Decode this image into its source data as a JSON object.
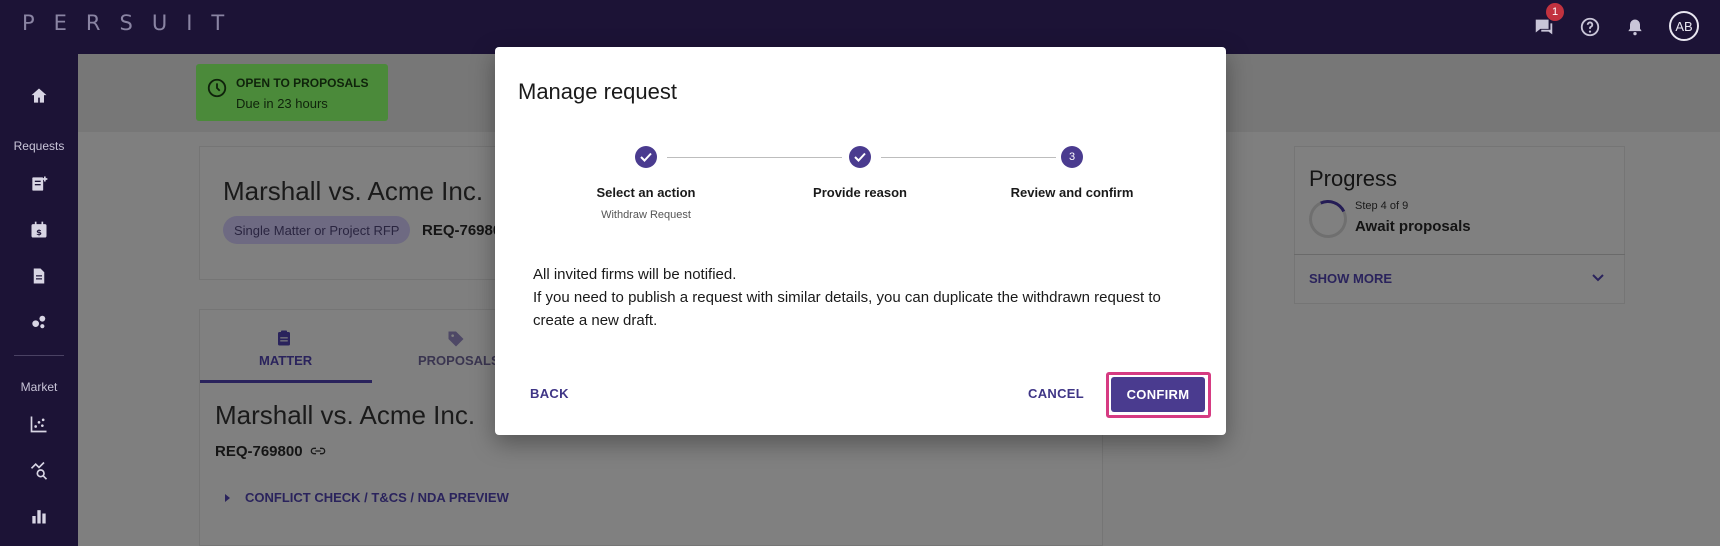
{
  "app": {
    "logo": "PERSUIT",
    "notification_count": "1",
    "user_initials": "AB"
  },
  "sidebar": {
    "requests_label": "Requests",
    "market_label": "Market"
  },
  "background": {
    "status_title": "OPEN TO PROPOSALS",
    "status_due": "Due in 23 hours",
    "header_title": "Marshall vs. Acme Inc.",
    "pill": "Single Matter or Project RFP",
    "header_req": "REQ-76980",
    "tabs": {
      "matter": "MATTER",
      "proposals": "PROPOSALS"
    },
    "body_title": "Marshall vs. Acme Inc.",
    "body_req": "REQ-769800",
    "conflict_link": "CONFLICT CHECK / T&CS / NDA PREVIEW",
    "progress": {
      "title": "Progress",
      "step": "Step 4 of 9",
      "step_name": "Await proposals",
      "show_more": "SHOW MORE"
    }
  },
  "modal": {
    "title": "Manage request",
    "steps": [
      {
        "label": "Select an action",
        "sub": "Withdraw Request",
        "marker": "check"
      },
      {
        "label": "Provide reason",
        "sub": "",
        "marker": "check"
      },
      {
        "label": "Review and confirm",
        "sub": "",
        "marker": "3"
      }
    ],
    "body_line1": "All invited firms will be notified.",
    "body_line2": "If you need to publish a request with similar details, you can duplicate the withdrawn request to create a new draft.",
    "back_label": "BACK",
    "cancel_label": "CANCEL",
    "confirm_label": "CONFIRM"
  },
  "colors": {
    "brand_dark": "#1c1336",
    "accent": "#4a3b8f",
    "highlight": "#d63b82",
    "status_green": "#4b8a3a"
  }
}
